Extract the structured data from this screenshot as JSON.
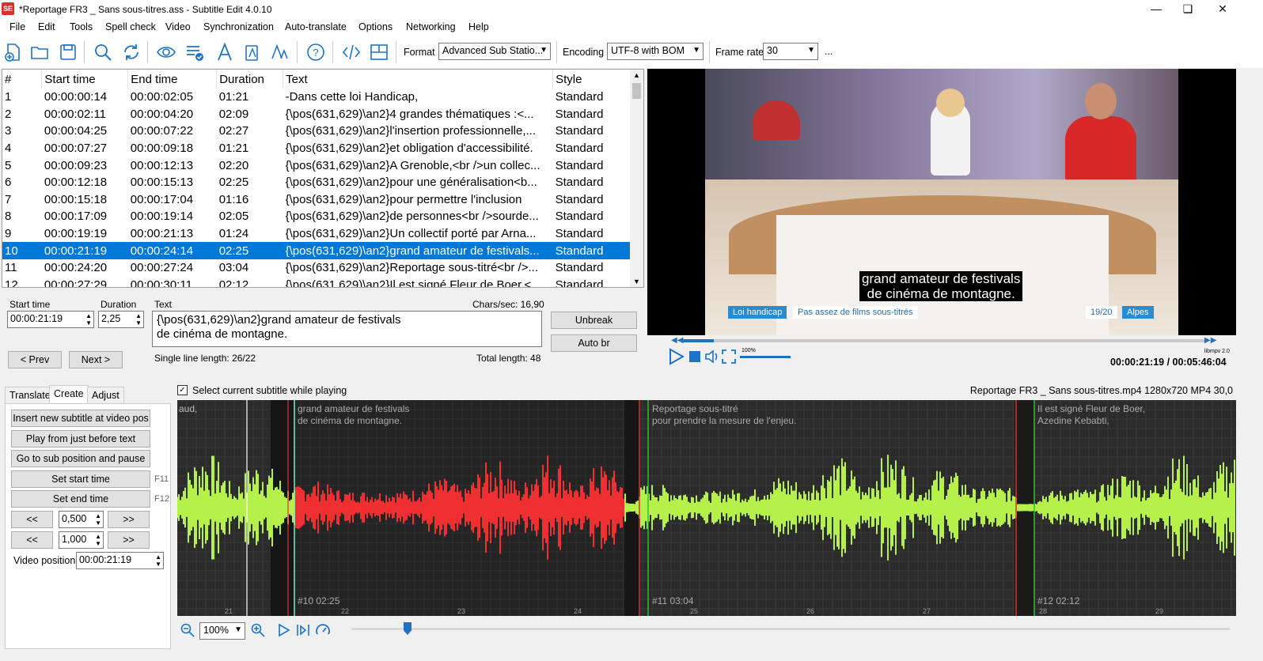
{
  "window": {
    "title": "*Reportage FR3 _ Sans sous-titres.ass - Subtitle Edit 4.0.10",
    "app_icon": "SE"
  },
  "menu": [
    "File",
    "Edit",
    "Tools",
    "Spell check",
    "Video",
    "Synchronization",
    "Auto-translate",
    "Options",
    "Networking",
    "Help"
  ],
  "toolbar": {
    "format_label": "Format",
    "format_value": "Advanced Sub Statio...",
    "encoding_label": "Encoding",
    "encoding_value": "UTF-8 with BOM",
    "framerate_label": "Frame rate",
    "framerate_value": "30",
    "more": "..."
  },
  "grid": {
    "headers": [
      "#",
      "Start time",
      "End time",
      "Duration",
      "Text",
      "Style"
    ],
    "rows": [
      [
        "1",
        "00:00:00:14",
        "00:00:02:05",
        "01:21",
        "-Dans cette loi Handicap,",
        "Standard"
      ],
      [
        "2",
        "00:00:02:11",
        "00:00:04:20",
        "02:09",
        "{\\pos(631,629)\\an2}4 grandes thématiques :<...",
        "Standard"
      ],
      [
        "3",
        "00:00:04:25",
        "00:00:07:22",
        "02:27",
        "{\\pos(631,629)\\an2}l'insertion professionnelle,...",
        "Standard"
      ],
      [
        "4",
        "00:00:07:27",
        "00:00:09:18",
        "01:21",
        "{\\pos(631,629)\\an2}et obligation d'accessibilité.",
        "Standard"
      ],
      [
        "5",
        "00:00:09:23",
        "00:00:12:13",
        "02:20",
        "{\\pos(631,629)\\an2}A Grenoble,<br />un collec...",
        "Standard"
      ],
      [
        "6",
        "00:00:12:18",
        "00:00:15:13",
        "02:25",
        "{\\pos(631,629)\\an2}pour une généralisation<b...",
        "Standard"
      ],
      [
        "7",
        "00:00:15:18",
        "00:00:17:04",
        "01:16",
        "{\\pos(631,629)\\an2}pour permettre l'inclusion",
        "Standard"
      ],
      [
        "8",
        "00:00:17:09",
        "00:00:19:14",
        "02:05",
        "{\\pos(631,629)\\an2}de personnes<br />sourde...",
        "Standard"
      ],
      [
        "9",
        "00:00:19:19",
        "00:00:21:13",
        "01:24",
        "{\\pos(631,629)\\an2}Un collectif porté par Arna...",
        "Standard"
      ],
      [
        "10",
        "00:00:21:19",
        "00:00:24:14",
        "02:25",
        "{\\pos(631,629)\\an2}grand amateur de festivals...",
        "Standard"
      ],
      [
        "11",
        "00:00:24:20",
        "00:00:27:24",
        "03:04",
        "{\\pos(631,629)\\an2}Reportage sous-titré<br />...",
        "Standard"
      ],
      [
        "12",
        "00:00:27:29",
        "00:00:30:11",
        "02:12",
        "{\\pos(631,629)\\an2}Il est signé Fleur de Boer,<...",
        "Standard"
      ]
    ],
    "selected_index": 9
  },
  "edit": {
    "start_label": "Start time",
    "start_value": "00:00:21:19",
    "duration_label": "Duration",
    "duration_value": "2,25",
    "text_label": "Text",
    "chars_sec": "Chars/sec: 16,90",
    "text_line1": "{\\pos(631,629)\\an2}grand amateur de festivals",
    "text_line2": "de cinéma de montagne.",
    "unbreak": "Unbreak",
    "auto_br": "Auto br",
    "prev": "< Prev",
    "next": "Next >",
    "single_line": "Single line length: 26/22",
    "total_length": "Total length: 48"
  },
  "video": {
    "subtitle_line1": "grand amateur de festivals",
    "subtitle_line2": "de cinéma de montagne.",
    "banner_left1": "Loi handicap",
    "banner_left2": "Pas assez de films sous-titrés",
    "banner_right1": "19/20",
    "banner_right2": "Alpes",
    "volume": "100%",
    "engine": "libmpv 2.0",
    "time": "00:00:21:19 / 00:05:46:04"
  },
  "tabs": [
    "Translate",
    "Create",
    "Adjust"
  ],
  "create": {
    "insert": "Insert new subtitle at video pos",
    "play_before": "Play from just before text",
    "goto_pause": "Go to sub position and pause",
    "set_start": "Set start time",
    "set_start_key": "F11",
    "set_end": "Set end time",
    "set_end_key": "F12",
    "back": "<<",
    "fwd": ">>",
    "step1": "0,500",
    "step2": "1,000",
    "video_pos_label": "Video position:",
    "video_pos_value": "00:00:21:19"
  },
  "waveform": {
    "select_current_label": "Select current subtitle while playing",
    "file_info": "Reportage FR3 _ Sans sous-titres.mp4 1280x720 MP4 30,0",
    "prev_text": "aud,",
    "sub10_line1": "grand amateur de festivals",
    "sub10_line2": "de cinéma de montagne.",
    "sub11_line1": "Reportage sous-titré",
    "sub11_line2": "pour prendre la mesure de l'enjeu.",
    "sub12_line1": "Il est signé Fleur de Boer,",
    "sub12_line2": "Azedine Kebabti,",
    "label10": "#10  02:25",
    "label11": "#11  03:04",
    "label12": "#12  02:12",
    "ticks": [
      "21",
      "22",
      "23",
      "24",
      "25",
      "26",
      "27",
      "28",
      "29"
    ],
    "zoom": "100%"
  },
  "colors": {
    "selection": "#0078d7",
    "wave_green": "#b6f04a",
    "wave_red": "#f03030",
    "wave_bg": "#2b2b2b"
  }
}
